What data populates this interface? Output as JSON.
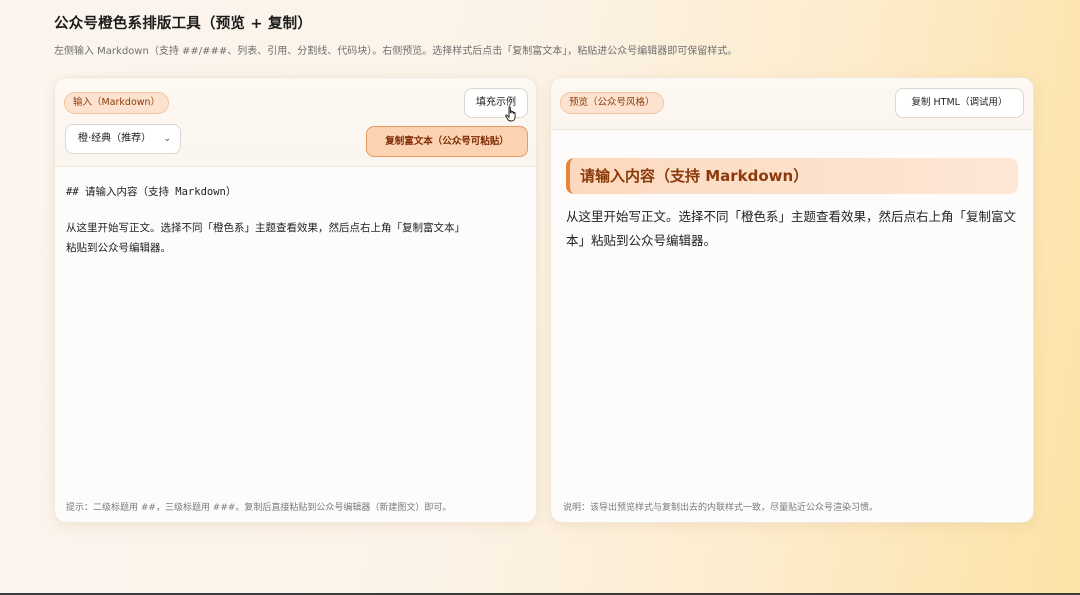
{
  "header": {
    "title": "公众号橙色系排版工具（预览 + 复制）",
    "subtitle": "左侧输入 Markdown（支持 ##/###、列表、引用、分割线、代码块）。右侧预览。选择样式后点击「复制富文本」，粘贴进公众号编辑器即可保留样式。"
  },
  "input_panel": {
    "badge": "输入（Markdown）",
    "fill_example_button": "填充示例",
    "theme_select_value": "橙·经典（推荐）",
    "copy_rich_button": "复制富文本（公众号可粘贴）",
    "editor_lines": [
      "## 请输入内容（支持 Markdown）",
      "从这里开始写正文。选择不同「橙色系」主题查看效果，然后点右上角「复制富文本」",
      "粘贴到公众号编辑器。"
    ],
    "footnote": "提示：二级标题用 ##，三级标题用 ###。复制后直接粘贴到公众号编辑器（新建图文）即可。"
  },
  "preview_panel": {
    "badge": "预览（公众号风格）",
    "copy_html_button": "复制 HTML（调试用）",
    "heading": "请输入内容（支持 Markdown）",
    "paragraph": "从这里开始写正文。选择不同「橙色系」主题查看效果，然后点右上角「复制富文本」粘贴到公众号编辑器。",
    "footnote": "说明：该导出预览样式与复制出去的内联样式一致，尽量贴近公众号渲染习惯。"
  },
  "colors": {
    "accent": "#e8843c",
    "heading_text": "#8b3a0b",
    "badge_bg": "#fde3cf"
  },
  "icons": {
    "cursor": "hand-pointer-icon",
    "select_arrow": "chevron-down-icon"
  }
}
